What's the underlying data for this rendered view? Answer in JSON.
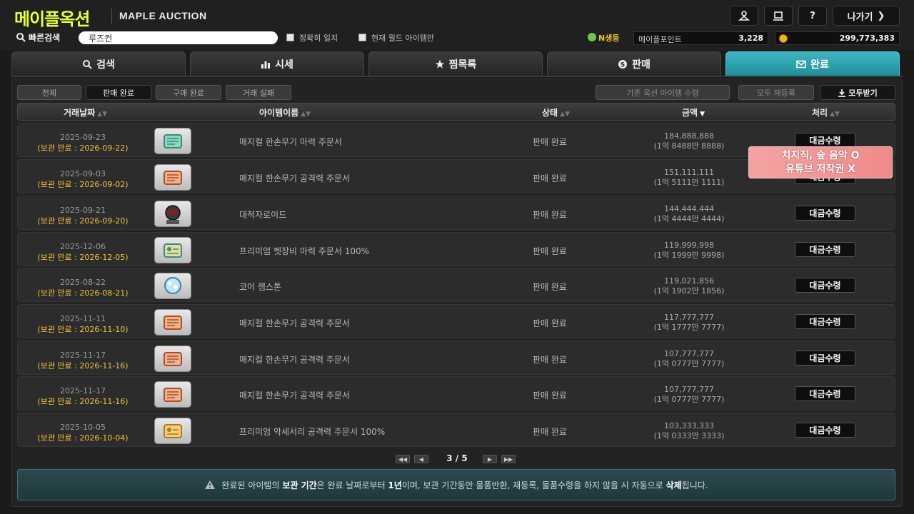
{
  "header": {
    "logo_ko": "메이플옥션",
    "logo_en": "MAPLE AUCTION",
    "btn_back": "나가기"
  },
  "quick_search": {
    "label": "빠른검색",
    "value": "루즈컨",
    "exact_label": "정확히 일치",
    "world_label": "현재 월드 아이템만"
  },
  "points": {
    "nsec_label": "N생둥",
    "maple_point_label": "메이플포인트",
    "maple_point_value": "3,228",
    "meso_value": "299,773,383"
  },
  "tabs": [
    {
      "label": "검색",
      "icon": "search-icon"
    },
    {
      "label": "시세",
      "icon": "bar-chart-icon"
    },
    {
      "label": "찜목록",
      "icon": "star-icon"
    },
    {
      "label": "판매",
      "icon": "sell-coin-icon"
    },
    {
      "label": "완료",
      "icon": "mail-check-icon"
    }
  ],
  "filter_tabs": [
    "전체",
    "판매 완료",
    "구매 완료",
    "거래 실패"
  ],
  "actions": {
    "register_existing": "기존 옥션 아이템 수령",
    "reregister_all": "모두 재등록",
    "receive_all": "모두받기"
  },
  "columns": {
    "date": "거래날짜",
    "name": "아이템이름",
    "status": "상태",
    "amount": "금액",
    "process": "처리"
  },
  "rows": [
    {
      "date": "2025-09-23",
      "keep": "(보관 만료 : 2026-09-22)",
      "name": "매지컬 한손무기 마력 주문서",
      "status": "판매 완료",
      "amount": "184,888,888",
      "amount_ko": "(1억 8488만 8888)",
      "action": "대금수령",
      "icon": "scroll-teal-icon"
    },
    {
      "date": "2025-09-03",
      "keep": "(보관 만료 : 2026-09-02)",
      "name": "매지컬 한손무기 공격력 주문서",
      "status": "판매 완료",
      "amount": "151,111,111",
      "amount_ko": "(1억 5111만 1111)",
      "action": "대금수령",
      "icon": "scroll-red-icon"
    },
    {
      "date": "2025-09-21",
      "keep": "(보관 만료 : 2026-09-20)",
      "name": "대적자로이드",
      "status": "판매 완료",
      "amount": "144,444,444",
      "amount_ko": "(1억 4444만 4444)",
      "action": "대금수령",
      "icon": "android-icon"
    },
    {
      "date": "2025-12-06",
      "keep": "(보관 만료 : 2026-12-05)",
      "name": "프리미엄 펫장비 마력 주문서 100%",
      "status": "판매 완료",
      "amount": "119,999,998",
      "amount_ko": "(1억 1999만 9998)",
      "action": "대금수령",
      "icon": "scroll-pet-icon"
    },
    {
      "date": "2025-08-22",
      "keep": "(보관 만료 : 2026-08-21)",
      "name": "코어 젬스톤",
      "status": "판매 완료",
      "amount": "119,021,856",
      "amount_ko": "(1억 1902만 1856)",
      "action": "대금수령",
      "icon": "core-gemstone-icon"
    },
    {
      "date": "2025-11-11",
      "keep": "(보관 만료 : 2026-11-10)",
      "name": "매지컬 한손무기 공격력 주문서",
      "status": "판매 완료",
      "amount": "117,777,777",
      "amount_ko": "(1억 1777만 7777)",
      "action": "대금수령",
      "icon": "scroll-red-icon"
    },
    {
      "date": "2025-11-17",
      "keep": "(보관 만료 : 2026-11-16)",
      "name": "매지컬 한손무기 공격력 주문서",
      "status": "판매 완료",
      "amount": "107,777,777",
      "amount_ko": "(1억 0777만 7777)",
      "action": "대금수령",
      "icon": "scroll-red-icon"
    },
    {
      "date": "2025-11-17",
      "keep": "(보관 만료 : 2026-11-16)",
      "name": "매지컬 한손무기 공격력 주문서",
      "status": "판매 완료",
      "amount": "107,777,777",
      "amount_ko": "(1억 0777만 7777)",
      "action": "대금수령",
      "icon": "scroll-red-icon"
    },
    {
      "date": "2025-10-05",
      "keep": "(보관 만료 : 2026-10-04)",
      "name": "프리미엄 악세서리 공격력 주문서 100%",
      "status": "판매 완료",
      "amount": "103,333,333",
      "amount_ko": "(1억 0333만 3333)",
      "action": "대금수령",
      "icon": "scroll-gold-icon"
    }
  ],
  "pagination": {
    "current_text": "3 / 5"
  },
  "notice": {
    "p1": "완료된 아이템의 ",
    "b1": "보관 기간",
    "p2": "은 완료 날짜로부터 ",
    "b2": "1년",
    "p3": "이며, 보관 기간동안 물품반환, 재등록, 물품수령을 하지 않을 시 자동으로 ",
    "b3": "삭제",
    "p4": "됩니다."
  },
  "overlay": {
    "line1": "치지직, 숲 음악 O",
    "line2": "유튜브 저작권 X"
  },
  "colors": {
    "accent": "#2ba6b2",
    "logo": "#e8ff35",
    "expiry": "#f0c43a",
    "overlay": "#f08a8a"
  }
}
